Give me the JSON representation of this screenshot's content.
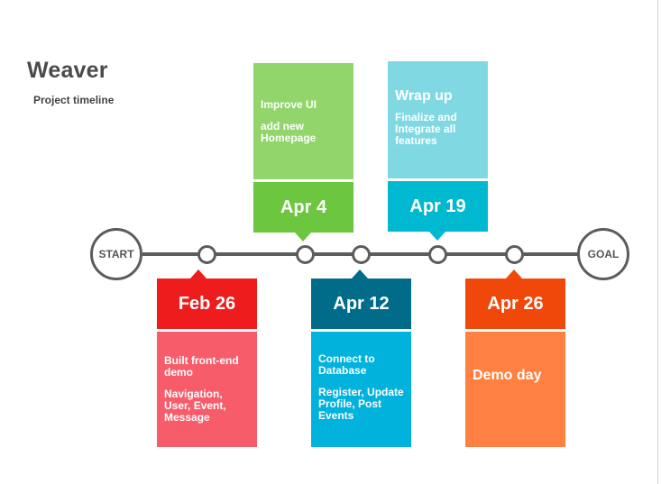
{
  "header": {
    "title": "Weaver",
    "subtitle": "Project timeline"
  },
  "timeline": {
    "start": "START",
    "goal": "GOAL"
  },
  "milestones": [
    {
      "date": "Feb 26",
      "lines": [
        "Built front-end demo",
        "Navigation, User, Event, Message"
      ],
      "date_color": "#ee1c1c",
      "body_color": "#f75c6b"
    },
    {
      "date": "Apr 4",
      "lines": [
        "Improve UI",
        "add new Homepage"
      ],
      "date_color": "#6cc63f",
      "body_color": "#92d56b"
    },
    {
      "date": "Apr 12",
      "lines": [
        "Connect to Database",
        "Register, Update Profile, Post Events"
      ],
      "date_color": "#006c8a",
      "body_color": "#00b2dc"
    },
    {
      "date": "Apr 19",
      "heading": "Wrap up",
      "lines": [
        "Finalize and Integrate all features"
      ],
      "date_color": "#00b8cf",
      "body_color": "#80d9e2"
    },
    {
      "date": "Apr 26",
      "lines": [
        "Demo day"
      ],
      "date_color": "#f0480a",
      "body_color": "#ff8040"
    }
  ]
}
